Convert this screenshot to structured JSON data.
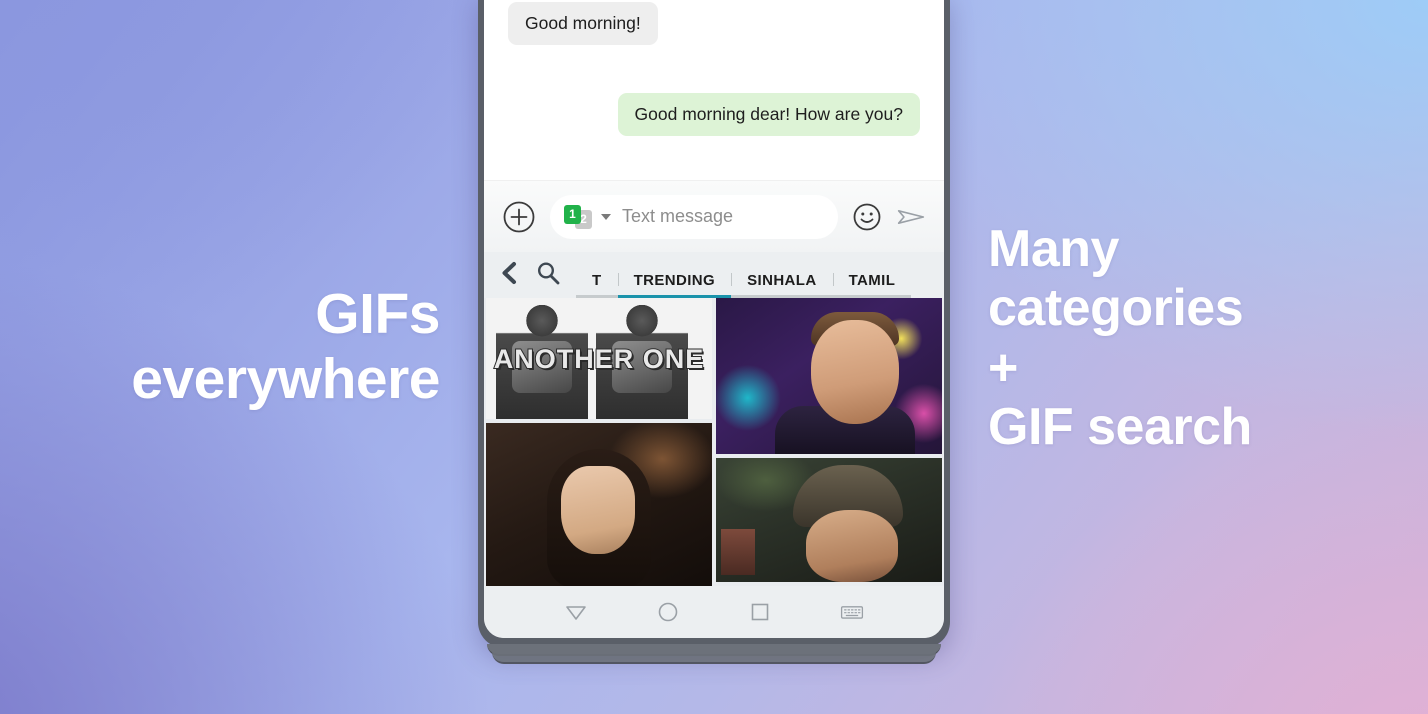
{
  "background": {
    "gradient_from": "#8b97df",
    "gradient_to": "#cdb3da",
    "accent_sky": "#9ccdf8",
    "accent_pink": "#e4b0d4"
  },
  "marketing": {
    "left_headline": "GIFs\neverywhere",
    "right_headline": "Many\ncategories\n+\nGIF search",
    "text_color": "#ffffff"
  },
  "phone": {
    "frame_color": "#5a5f68",
    "screen_background": "#ffffff"
  },
  "conversation": {
    "messages": [
      {
        "text": "Good morning!",
        "direction": "incoming",
        "bubble_color": "#eeeeee"
      },
      {
        "text": "Good morning dear! How are you?",
        "direction": "outgoing",
        "bubble_color": "#ddf3d6"
      }
    ]
  },
  "input_bar": {
    "attach_icon": "plus-circle-icon",
    "sim_selector": {
      "active_slot": "1",
      "inactive_slot": "2",
      "active_color": "#21b24a",
      "inactive_color": "#c9c9c9",
      "caret_icon": "chevron-down-icon"
    },
    "placeholder": "Text message",
    "value": "",
    "emoji_icon": "smiley-icon",
    "send_icon": "send-plane-icon"
  },
  "gif_panel": {
    "back_icon": "chevron-left-icon",
    "search_icon": "search-icon",
    "active_tab": "TRENDING",
    "active_underline_color": "#1a93ab",
    "inactive_underline_color": "#c6cbcd",
    "tabs": [
      {
        "label": "T",
        "active": false
      },
      {
        "label": "TRENDING",
        "active": true
      },
      {
        "label": "SINHALA",
        "active": false
      },
      {
        "label": "TAMIL",
        "active": false
      }
    ],
    "tiles": [
      {
        "name": "another-one-meme",
        "caption": "ANOTHER ONE",
        "column": "left"
      },
      {
        "name": "stage-smile-gif",
        "caption": "",
        "column": "right"
      },
      {
        "name": "woman-portrait-gif",
        "caption": "",
        "column": "left"
      },
      {
        "name": "man-foliage-gif",
        "caption": "",
        "column": "right"
      }
    ]
  },
  "nav_bar": {
    "buttons": [
      {
        "name": "back-button",
        "icon": "triangle-down-icon"
      },
      {
        "name": "home-button",
        "icon": "circle-icon"
      },
      {
        "name": "recents-button",
        "icon": "square-icon"
      },
      {
        "name": "keyboard-button",
        "icon": "keyboard-icon"
      }
    ]
  }
}
